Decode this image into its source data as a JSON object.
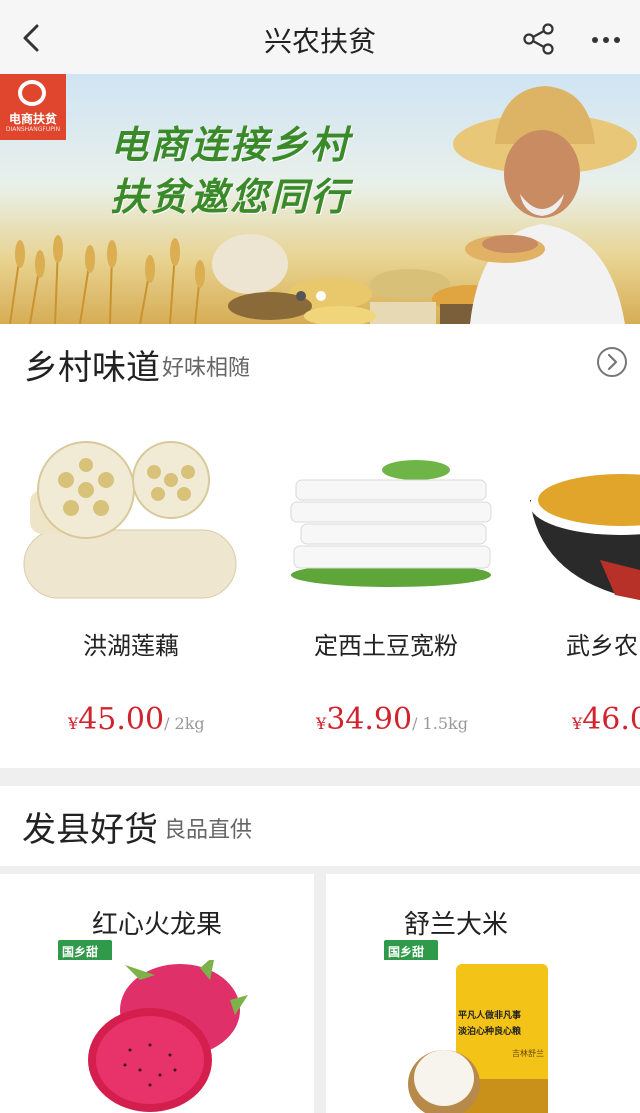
{
  "nav": {
    "title": "兴农扶贫",
    "back_icon": "chevron-left-icon",
    "share_icon": "share-icon",
    "more_icon": "more-dots-icon"
  },
  "banner": {
    "logo_text": "电商扶贫",
    "logo_subtext": "DIANSHANGFUPIN",
    "slogan_line1": "电商连接乡村",
    "slogan_line2": "扶贫邀您同行",
    "slide_count": 2,
    "active_slide": 1
  },
  "section1": {
    "title": "乡村味道",
    "subtitle": "好味相随",
    "more_icon": "chevron-circle-right-icon",
    "products": [
      {
        "name": "洪湖莲藕",
        "currency": "¥",
        "price": "45.00",
        "unit": "/ 2kg"
      },
      {
        "name": "定西土豆宽粉",
        "currency": "¥",
        "price": "34.90",
        "unit": "/ 1.5kg"
      },
      {
        "name": "武乡农",
        "currency": "¥",
        "price": "46.0",
        "unit": ""
      }
    ]
  },
  "section2": {
    "title": "发县好货",
    "subtitle": "良品直供",
    "products": [
      {
        "name": "红心火龙果",
        "badge": "国乡甜"
      },
      {
        "name": "舒兰大米",
        "badge": "国乡甜",
        "bag_text1": "平凡人做非凡事",
        "bag_text2": "淡泊心种良心粮",
        "bag_text3": "吉林舒兰"
      }
    ]
  },
  "colors": {
    "price": "#d0252f",
    "accent_green": "#2f9a4a",
    "logo_red": "#e0452d"
  }
}
